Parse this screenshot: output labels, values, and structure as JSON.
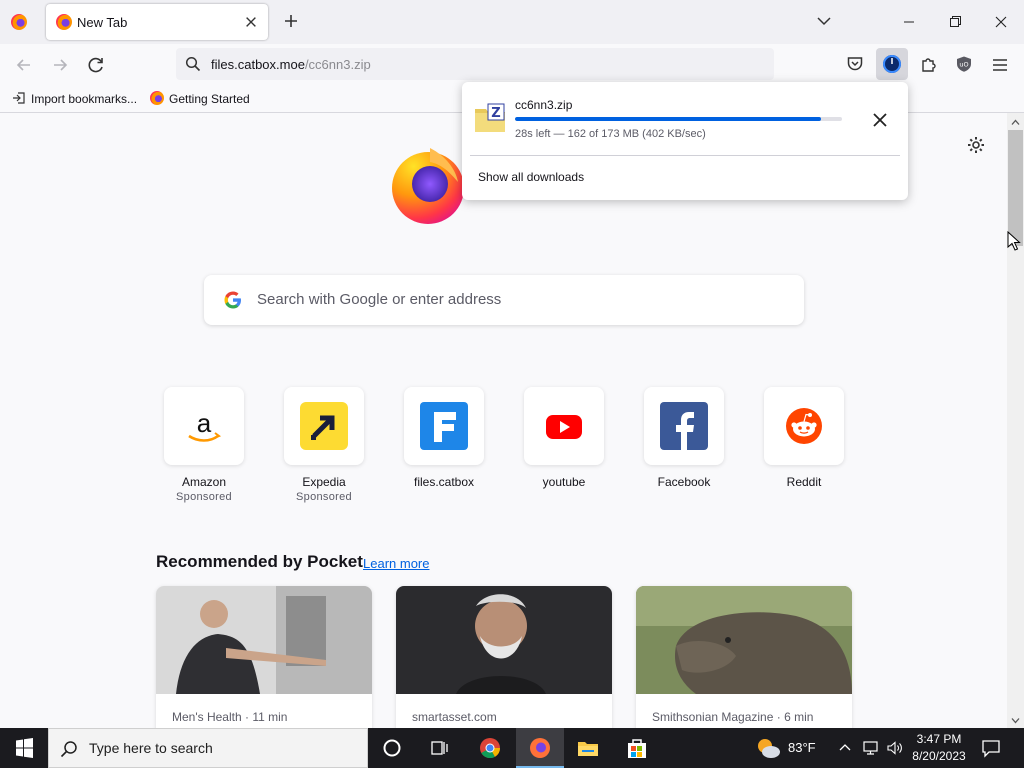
{
  "browser": {
    "tab": {
      "title": "New Tab"
    },
    "url": {
      "host": "files.catbox.moe",
      "path": "/cc6nn3.zip"
    },
    "bookmarks": [
      {
        "label": "Import bookmarks..."
      },
      {
        "label": "Getting Started"
      }
    ]
  },
  "downloads_panel": {
    "filename": "cc6nn3.zip",
    "status": "28s left — 162 of 173 MB (402 KB/sec)",
    "progress": 0.936,
    "show_all": "Show all downloads"
  },
  "newtab": {
    "search_placeholder": "Search with Google or enter address",
    "shortcuts": [
      {
        "label": "Amazon",
        "sponsored": "Sponsored",
        "icon": "amazon-icon"
      },
      {
        "label": "Expedia",
        "sponsored": "Sponsored",
        "icon": "expedia-icon"
      },
      {
        "label": "files.catbox",
        "sponsored": "",
        "icon": "catbox-icon"
      },
      {
        "label": "youtube",
        "sponsored": "",
        "icon": "youtube-icon"
      },
      {
        "label": "Facebook",
        "sponsored": "",
        "icon": "facebook-icon"
      },
      {
        "label": "Reddit",
        "sponsored": "",
        "icon": "reddit-icon"
      }
    ],
    "pocket": {
      "heading": "Recommended by Pocket",
      "learn_more": "Learn more",
      "cards": [
        {
          "source": "Men's Health · 11 min"
        },
        {
          "source": "smartasset.com"
        },
        {
          "source": "Smithsonian Magazine · 6 min"
        }
      ]
    }
  },
  "taskbar": {
    "search_placeholder": "Type here to search",
    "weather": "83°F",
    "time": "3:47 PM",
    "date": "8/20/2023"
  },
  "colors": {
    "accent": "#0061e0",
    "progress": "#0061e0",
    "taskbar": "#1b1b1f"
  }
}
